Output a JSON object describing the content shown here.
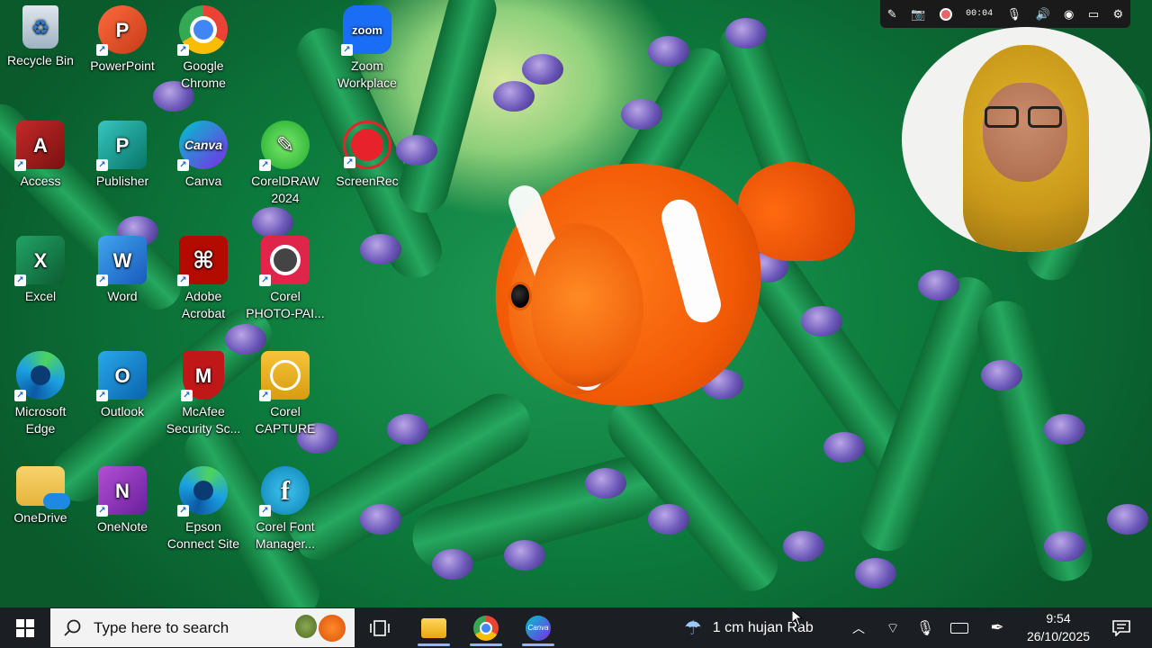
{
  "desktop": {
    "icons": [
      {
        "label": "Recycle Bin"
      },
      {
        "label": "PowerPoint"
      },
      {
        "label": "Google Chrome"
      },
      {
        "label": "Zoom Workplace"
      },
      {
        "label": "Access"
      },
      {
        "label": "Publisher"
      },
      {
        "label": "Canva"
      },
      {
        "label": "CorelDRAW 2024"
      },
      {
        "label": "ScreenRec"
      },
      {
        "label": "Excel"
      },
      {
        "label": "Word"
      },
      {
        "label": "Adobe Acrobat"
      },
      {
        "label": "Corel PHOTO-PAI..."
      },
      {
        "label": "Microsoft Edge"
      },
      {
        "label": "Outlook"
      },
      {
        "label": "McAfee Security Sc..."
      },
      {
        "label": "Corel CAPTURE"
      },
      {
        "label": "OneDrive"
      },
      {
        "label": "OneNote"
      },
      {
        "label": "Epson Connect Site"
      },
      {
        "label": "Corel Font Manager..."
      }
    ],
    "glyphs": {
      "powerpoint": "P",
      "zoom": "zoom",
      "access": "A",
      "publisher": "P",
      "canva": "Canva",
      "excel": "X",
      "word": "W",
      "outlook": "O",
      "onenote": "N",
      "font": "f",
      "shortcut_arrow": "↗"
    }
  },
  "recorder": {
    "timer": "00:04"
  },
  "taskbar": {
    "search_placeholder": "Type here to search",
    "weather_text": "1 cm hujan Rab",
    "time": "9:54",
    "date": "26/10/2025",
    "canva_label": "Canva"
  },
  "colors": {
    "taskbar": "#1b1f24",
    "search_box": "#f3f3f3",
    "accent": "#8fb8ff"
  }
}
